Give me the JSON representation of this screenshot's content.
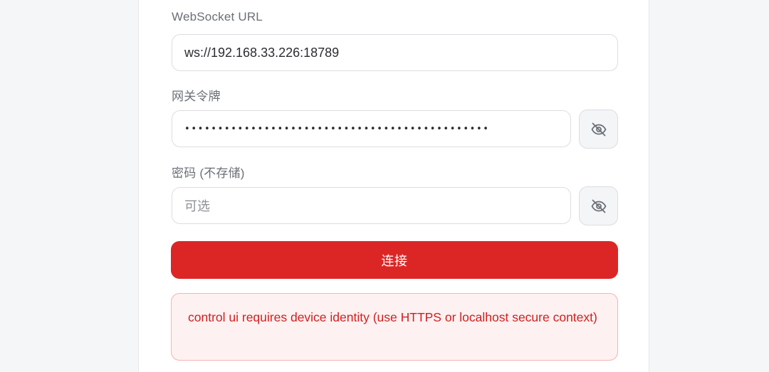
{
  "form": {
    "ws_label": "WebSocket URL",
    "ws_value": "ws://192.168.33.226:18789",
    "token_label": "网关令牌",
    "token_mask": "••••••••••••••••••••••••••••••••••••••••••••••",
    "password_label": "密码 (不存储)",
    "password_placeholder": "可选",
    "connect_label": "连接",
    "error_message": "control ui requires device identity (use HTTPS or localhost secure context)"
  },
  "icons": {
    "toggle_visibility": "eye-off-icon"
  },
  "colors": {
    "primary": "#dc2626",
    "error_text": "#d02020",
    "error_bg": "#fef1f1",
    "error_border": "#f6b3b3"
  }
}
